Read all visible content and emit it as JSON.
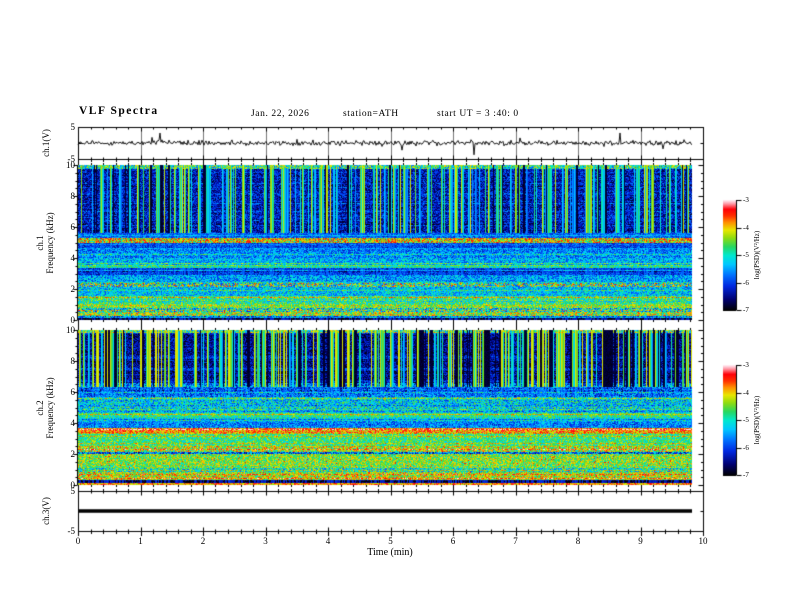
{
  "header": {
    "title": "VLF Spectra",
    "date": "Jan. 22, 2026",
    "station": "station=ATH",
    "start_ut": "start UT =  3 :40: 0"
  },
  "colors": {
    "background": "#ffffff",
    "text": "#000000",
    "frame": "#000000",
    "waveform": "#000000",
    "grid_minute": "#777777"
  },
  "chart_data": {
    "x_axis": {
      "label": "Time (min)",
      "min": 0,
      "max": 10,
      "major_ticks": [
        0,
        1,
        2,
        3,
        4,
        5,
        6,
        7,
        8,
        9,
        10
      ],
      "labels": [
        "0",
        "1",
        "2",
        "3",
        "4",
        "5",
        "6",
        "7",
        "8",
        "9",
        "10"
      ],
      "minor_step": 0.2,
      "data_end_min": 9.83
    },
    "panels": [
      {
        "id": "ch1_waveform",
        "type": "line",
        "ylabel": "ch.1(V)",
        "ylim": [
          -5,
          5
        ],
        "yticks": [
          {
            "v": 5,
            "label": "5"
          },
          {
            "v": -5,
            "label": "-5"
          }
        ],
        "grid_minutes": true,
        "signal": {
          "baseline_v": 0,
          "noise_sd_v": 0.38,
          "spike_prob": 0.016,
          "spike_v_min": 1.5,
          "spike_v_max": 4.3,
          "down_bias": 0.6,
          "seed": 777
        }
      },
      {
        "id": "ch1_spectrogram",
        "type": "heatmap",
        "ylabel_lines": [
          "ch.1",
          "Frequency (kHz)"
        ],
        "ylim_khz": [
          0,
          10
        ],
        "yticks": [
          {
            "v": 0,
            "label": "0"
          },
          {
            "v": 2,
            "label": "2"
          },
          {
            "v": 4,
            "label": "4"
          },
          {
            "v": 6,
            "label": "6"
          },
          {
            "v": 8,
            "label": "8"
          },
          {
            "v": 10,
            "label": "10"
          }
        ],
        "minor_khz": 0.5,
        "seed": 12345,
        "hline_prob": 0.38,
        "bands": [
          [
            9.75,
            10.01,
            0.52,
            0.25,
            0,
            0
          ],
          [
            5.6,
            9.75,
            0.17,
            0.14,
            0,
            0
          ],
          [
            5.3,
            5.6,
            0.3,
            0.12,
            0,
            0
          ],
          [
            5.0,
            5.3,
            0.72,
            0.22,
            0.04,
            0.9
          ],
          [
            4.6,
            5.0,
            0.25,
            0.12,
            0,
            0
          ],
          [
            4.0,
            4.6,
            0.33,
            0.16,
            0,
            0
          ],
          [
            3.55,
            4.0,
            0.4,
            0.16,
            0,
            0
          ],
          [
            3.38,
            3.55,
            0.52,
            0.14,
            0,
            0
          ],
          [
            2.9,
            3.38,
            0.24,
            0.12,
            0,
            0
          ],
          [
            2.4,
            2.9,
            0.38,
            0.16,
            0,
            0
          ],
          [
            2.1,
            2.4,
            0.55,
            0.3,
            0.06,
            0.88
          ],
          [
            1.55,
            2.1,
            0.42,
            0.16,
            0,
            0
          ],
          [
            1.0,
            1.55,
            0.55,
            0.18,
            0,
            0
          ],
          [
            0.75,
            1.0,
            0.62,
            0.16,
            0,
            0
          ],
          [
            0.5,
            0.75,
            0.48,
            0.28,
            0,
            0
          ],
          [
            0.28,
            0.5,
            0.66,
            0.2,
            0.03,
            0.8
          ],
          [
            0.15,
            0.28,
            0.4,
            0.2,
            0,
            0
          ],
          [
            0,
            0.15,
            0.04,
            0.06,
            0,
            0
          ]
        ],
        "streaks": {
          "density": 0.3,
          "strength_min": 0.25,
          "strength_max": 0.65,
          "drop_prob": 0.05,
          "full_above_khz": 5.6,
          "mid_above_khz": 2.9,
          "w_high": 0.95,
          "w_mid": 0.3,
          "w_low": 0.15
        }
      },
      {
        "id": "ch2_spectrogram",
        "type": "heatmap",
        "ylabel_lines": [
          "ch.2",
          "Frequency (kHz)"
        ],
        "ylim_khz": [
          0,
          10
        ],
        "yticks": [
          {
            "v": 0,
            "label": "0"
          },
          {
            "v": 2,
            "label": "2"
          },
          {
            "v": 4,
            "label": "4"
          },
          {
            "v": 6,
            "label": "6"
          },
          {
            "v": 8,
            "label": "8"
          },
          {
            "v": 10,
            "label": "10"
          }
        ],
        "minor_khz": 0.5,
        "seed": 54321,
        "hline_prob": 0.42,
        "bands": [
          [
            9.8,
            10.01,
            0.55,
            0.25,
            0,
            0
          ],
          [
            6.6,
            9.8,
            0.13,
            0.12,
            0,
            0
          ],
          [
            5.65,
            6.6,
            0.3,
            0.18,
            0,
            0
          ],
          [
            5.45,
            5.65,
            0.48,
            0.2,
            0,
            0
          ],
          [
            4.65,
            5.45,
            0.44,
            0.2,
            0,
            0
          ],
          [
            4.35,
            4.65,
            0.55,
            0.15,
            0,
            0
          ],
          [
            3.7,
            4.35,
            0.33,
            0.16,
            0,
            0
          ],
          [
            3.3,
            3.7,
            0.8,
            0.16,
            0.06,
            0.92
          ],
          [
            2.45,
            3.3,
            0.57,
            0.16,
            0,
            0
          ],
          [
            2.15,
            2.45,
            0.66,
            0.2,
            0.02,
            0.88
          ],
          [
            1.98,
            2.15,
            0.3,
            0.25,
            0,
            0
          ],
          [
            1.1,
            1.98,
            0.64,
            0.16,
            0.02,
            0.88
          ],
          [
            0.85,
            1.1,
            0.5,
            0.22,
            0,
            0
          ],
          [
            0.3,
            0.85,
            0.68,
            0.18,
            0.03,
            0.88
          ],
          [
            0.12,
            0.3,
            0.07,
            0.1,
            0,
            0
          ],
          [
            0,
            0.12,
            0.8,
            0.15,
            0,
            0
          ]
        ],
        "streaks": {
          "density": 0.38,
          "strength_min": 0.3,
          "strength_max": 0.8,
          "drop_prob": 0.1,
          "full_above_khz": 6.3,
          "mid_above_khz": 3.7,
          "w_high": 1.0,
          "w_mid": 0.3,
          "w_low": 0.15
        }
      },
      {
        "id": "ch3_waveform",
        "type": "line",
        "ylabel": "ch.3(V)",
        "ylim": [
          -5,
          5
        ],
        "yticks": [
          {
            "v": 5,
            "label": "5"
          },
          {
            "v": -5,
            "label": "-5"
          }
        ],
        "signal": {
          "flat_v": 0,
          "line_width": 3.5
        }
      }
    ],
    "colorbars": [
      {
        "label": "log(PSD)(V²/Hz)",
        "lim": [
          -7,
          -3
        ],
        "ticks": [
          {
            "v": -3,
            "label": "-3"
          },
          {
            "v": -4,
            "label": "-4"
          },
          {
            "v": -5,
            "label": "-5"
          },
          {
            "v": -6,
            "label": "-6"
          },
          {
            "v": -7,
            "label": "-7"
          }
        ]
      },
      {
        "label": "log(PSD)(V²/Hz)",
        "lim": [
          -7,
          -3
        ],
        "ticks": [
          {
            "v": -3,
            "label": "-3"
          },
          {
            "v": -4,
            "label": "-4"
          },
          {
            "v": -5,
            "label": "-5"
          },
          {
            "v": -6,
            "label": "-6"
          },
          {
            "v": -7,
            "label": "-7"
          }
        ]
      }
    ],
    "colormap_stops": [
      [
        0.0,
        "#000000"
      ],
      [
        0.1,
        "#000070"
      ],
      [
        0.22,
        "#0028e0"
      ],
      [
        0.32,
        "#0070ff"
      ],
      [
        0.42,
        "#00c8ff"
      ],
      [
        0.5,
        "#00e8d0"
      ],
      [
        0.58,
        "#28d860"
      ],
      [
        0.66,
        "#90dc10"
      ],
      [
        0.73,
        "#e8e800"
      ],
      [
        0.8,
        "#ff9000"
      ],
      [
        0.86,
        "#ff3000"
      ],
      [
        0.92,
        "#ff0008"
      ],
      [
        0.97,
        "#ff9aa8"
      ],
      [
        1.0,
        "#ffe8f0"
      ]
    ]
  }
}
